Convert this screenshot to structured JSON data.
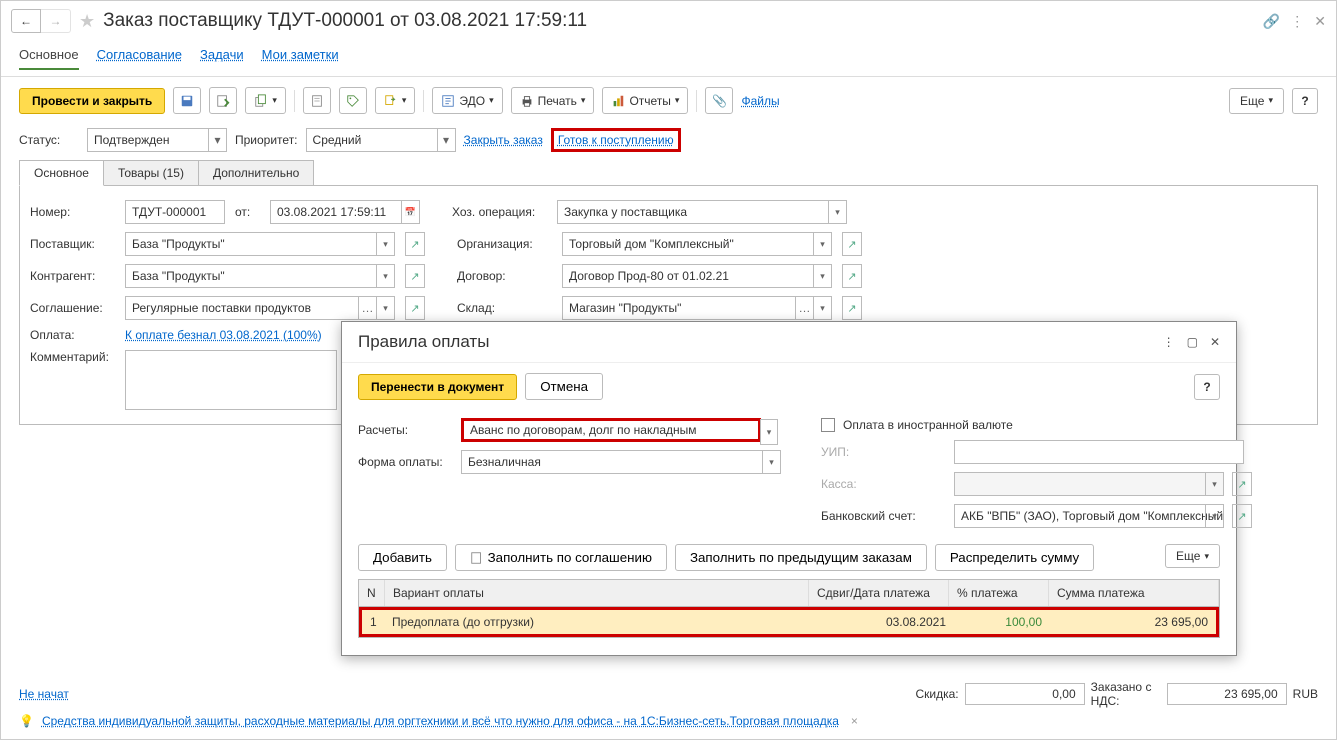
{
  "header": {
    "title": "Заказ поставщику ТДУТ-000001 от 03.08.2021 17:59:11"
  },
  "navTabs": {
    "main": "Основное",
    "approval": "Согласование",
    "tasks": "Задачи",
    "notes": "Мои заметки"
  },
  "toolbar": {
    "postClose": "Провести и закрыть",
    "edo": "ЭДО",
    "print": "Печать",
    "reports": "Отчеты",
    "files": "Файлы",
    "more": "Еще"
  },
  "statusRow": {
    "statusLbl": "Статус:",
    "statusVal": "Подтвержден",
    "priorityLbl": "Приоритет:",
    "priorityVal": "Средний",
    "closeOrder": "Закрыть заказ",
    "ready": "Готов к поступлению"
  },
  "contentTabs": {
    "main": "Основное",
    "goods": "Товары (15)",
    "extra": "Дополнительно"
  },
  "form": {
    "numberLbl": "Номер:",
    "numberVal": "ТДУТ-000001",
    "fromLbl": "от:",
    "dateVal": "03.08.2021 17:59:11",
    "operLbl": "Хоз. операция:",
    "operVal": "Закупка у поставщика",
    "supplierLbl": "Поставщик:",
    "supplierVal": "База \"Продукты\"",
    "orgLbl": "Организация:",
    "orgVal": "Торговый дом \"Комплексный\"",
    "counterLbl": "Контрагент:",
    "counterVal": "База \"Продукты\"",
    "contractLbl": "Договор:",
    "contractVal": "Договор Прод-80 от 01.02.21",
    "agreeLbl": "Соглашение:",
    "agreeVal": "Регулярные поставки продуктов",
    "wareLbl": "Склад:",
    "wareVal": "Магазин \"Продукты\"",
    "payLbl": "Оплата:",
    "payVal": "К оплате безнал 03.08.2021 (100%)",
    "commentLbl": "Комментарий:"
  },
  "popup": {
    "title": "Правила оплаты",
    "transfer": "Перенести в документ",
    "cancel": "Отмена",
    "calcLbl": "Расчеты:",
    "calcVal": "Аванс по договорам, долг по накладным",
    "foreignLbl": "Оплата в иностранной валюте",
    "payFormLbl": "Форма оплаты:",
    "payFormVal": "Безналичная",
    "uipLbl": "УИП:",
    "kassaLbl": "Касса:",
    "bankLbl": "Банковский счет:",
    "bankVal": "АКБ \"ВПБ\" (ЗАО), Торговый дом \"Комплексный",
    "add": "Добавить",
    "fillAgree": "Заполнить по соглашению",
    "fillPrev": "Заполнить по предыдущим заказам",
    "distribute": "Распределить сумму",
    "more": "Еще",
    "thN": "N",
    "thVariant": "Вариант оплаты",
    "thShift": "Сдвиг/Дата платежа",
    "thPercent": "% платежа",
    "thSum": "Сумма платежа",
    "rowN": "1",
    "rowVariant": "Предоплата (до отгрузки)",
    "rowDate": "03.08.2021",
    "rowPercent": "100,00",
    "rowSum": "23 695,00"
  },
  "footer": {
    "notStarted": "Не начат",
    "idea": "Средства индивидуальной защиты, расходные материалы для оргтехники и всё что нужно для офиса - на 1С:Бизнес-сеть.Торговая площадка",
    "discountLbl": "Скидка:",
    "discountVal": "0,00",
    "orderedLbl": "Заказано с НДС:",
    "orderedVal": "23 695,00",
    "currency": "RUB"
  }
}
